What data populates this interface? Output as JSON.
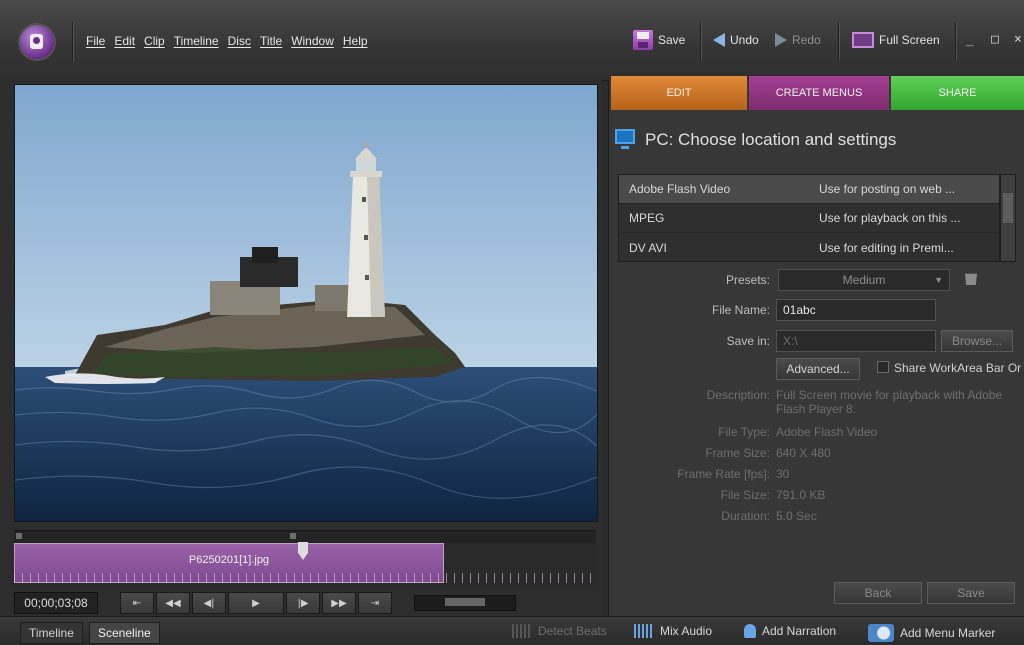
{
  "menu": [
    "File",
    "Edit",
    "Clip",
    "Timeline",
    "Disc",
    "Title",
    "Window",
    "Help"
  ],
  "toolbar": {
    "save": "Save",
    "undo": "Undo",
    "redo": "Redo",
    "fullscreen": "Full Screen",
    "minimize": "_",
    "maximize": "□",
    "close": "×"
  },
  "clip": {
    "name": "P6250201[1].jpg",
    "timecode": "00;00;03;08"
  },
  "tabs": {
    "edit": "EDIT",
    "menus": "CREATE MENUS",
    "share": "SHARE"
  },
  "share": {
    "title": "PC: Choose location and settings",
    "formats": [
      {
        "name": "Adobe Flash Video",
        "desc": "Use for posting on web ..."
      },
      {
        "name": "MPEG",
        "desc": "Use for playback on this ..."
      },
      {
        "name": "DV AVI",
        "desc": "Use for editing in Premi..."
      }
    ],
    "presets_label": "Presets:",
    "presets_value": "Medium",
    "filename_label": "File Name:",
    "filename_value": "01abc",
    "savein_label": "Save in:",
    "savein_value": "X:\\",
    "browse": "Browse...",
    "advanced": "Advanced...",
    "share_workarea": "Share WorkArea Bar Or",
    "description_label": "Description:",
    "description_value": "Full Screen movie for playback with Adobe Flash Player 8.",
    "filetype_label": "File Type:",
    "filetype_value": "Adobe Flash Video",
    "framesize_label": "Frame Size:",
    "framesize_value": "640 X 480",
    "framerate_label": "Frame Rate [fps]:",
    "framerate_value": "30",
    "filesize_label": "File Size:",
    "filesize_value": "791.0 KB",
    "duration_label": "Duration:",
    "duration_value": "5.0 Sec",
    "back": "Back",
    "save": "Save"
  },
  "bottom": {
    "timeline": "Timeline",
    "sceneline": "Sceneline",
    "detect_beats": "Detect Beats",
    "mix_audio": "Mix Audio",
    "add_narration": "Add Narration",
    "add_menu_marker": "Add Menu Marker"
  },
  "colors": {
    "edit": "#c8772a",
    "menus": "#8e3480",
    "share": "#45b841",
    "accent": "#4ea3e6"
  }
}
